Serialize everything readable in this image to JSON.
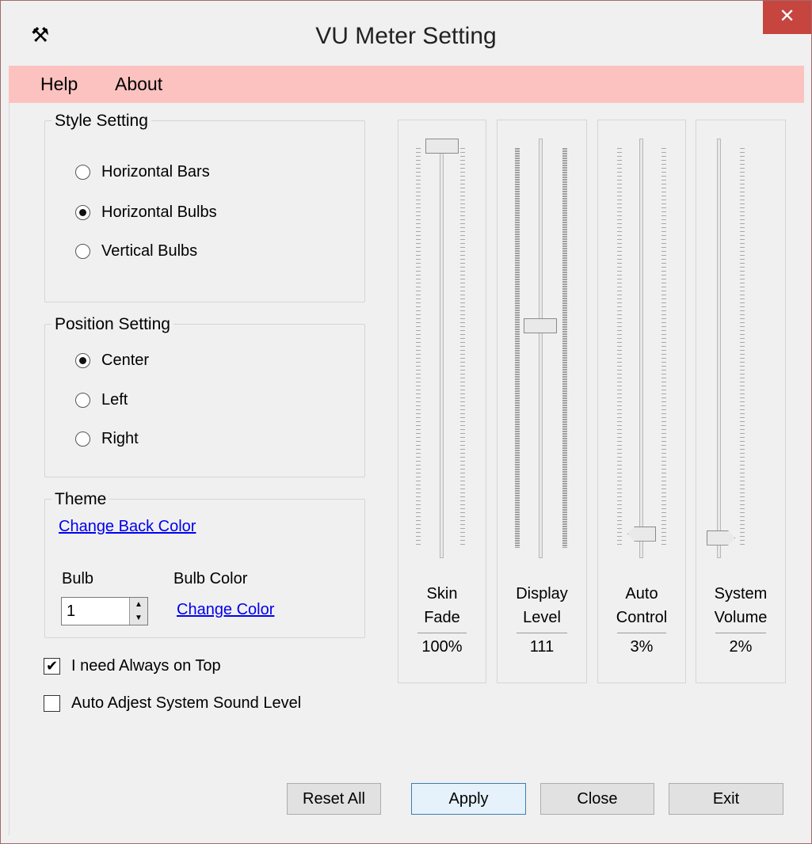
{
  "window": {
    "title": "VU Meter Setting",
    "close_symbol": "✕",
    "app_icon_glyph": "⚒"
  },
  "menu": {
    "items": [
      "Help",
      "About"
    ]
  },
  "style_setting": {
    "title": "Style Setting",
    "options": [
      {
        "label": "Horizontal Bars",
        "checked": false
      },
      {
        "label": "Horizontal Bulbs",
        "checked": true
      },
      {
        "label": "Vertical Bulbs",
        "checked": false
      }
    ]
  },
  "position_setting": {
    "title": "Position Setting",
    "options": [
      {
        "label": "Center",
        "checked": true
      },
      {
        "label": "Left",
        "checked": false
      },
      {
        "label": "Right",
        "checked": false
      }
    ]
  },
  "theme": {
    "title": "Theme",
    "change_back_color": "Change Back Color",
    "bulb_label": "Bulb",
    "bulb_value": "1",
    "bulb_color_label": "Bulb Color",
    "change_color": "Change Color"
  },
  "checkboxes": [
    {
      "label": "I need Always on Top",
      "checked": true,
      "mark": "✔"
    },
    {
      "label": "Auto Adjest System Sound Level",
      "checked": false,
      "mark": ""
    }
  ],
  "sliders": [
    {
      "label_line1": "Skin",
      "label_line2": "Fade",
      "value": "100%",
      "level": 1.0
    },
    {
      "label_line1": "Display",
      "label_line2": "Level",
      "value": "111",
      "level": 0.55
    },
    {
      "label_line1": "Auto",
      "label_line2": "Control",
      "value": "3%",
      "level": 0.03
    },
    {
      "label_line1": "System",
      "label_line2": "Volume",
      "value": "2%",
      "level": 0.02
    }
  ],
  "buttons": {
    "reset_all": "Reset All",
    "apply": "Apply",
    "close": "Close",
    "exit": "Exit"
  },
  "colors": {
    "menubar": "#fcc2c0",
    "close_button": "#c7453f",
    "link": "#0000ee"
  }
}
